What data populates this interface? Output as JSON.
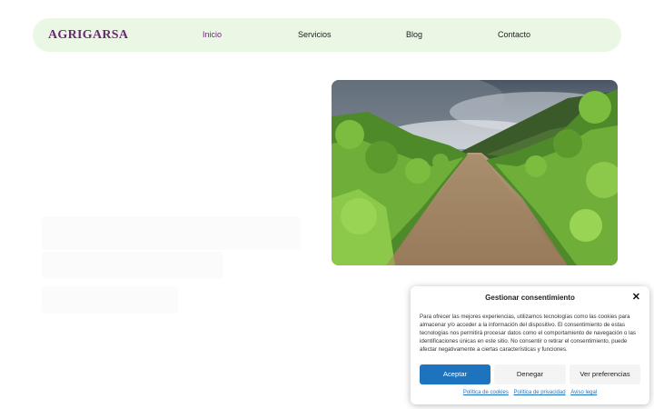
{
  "header": {
    "logo": "AGRIGARSA",
    "nav": [
      {
        "label": "Inicio"
      },
      {
        "label": "Servicios"
      },
      {
        "label": "Blog"
      },
      {
        "label": "Contacto"
      }
    ],
    "active_color": "#6a2a73",
    "background_color": "#e9f7e4"
  },
  "hero": {
    "image_icon": "vineyard-photo"
  },
  "cookie_banner": {
    "title": "Gestionar consentimiento",
    "close_icon": "close-icon",
    "text": "Para ofrecer las mejores experiencias, utilizamos tecnologías como las cookies para almacenar y/o acceder a la información del dispositivo. El consentimiento de estas tecnologías nos permitirá procesar datos como el comportamiento de navegación o las identificaciones únicas en este sitio. No consentir o retirar el consentimiento, puede afectar negativamente a ciertas características y funciones.",
    "buttons": {
      "accept": "Aceptar",
      "deny": "Denegar",
      "preferences": "Ver preferencias"
    },
    "links": {
      "cookies": "Política de cookies",
      "privacy": "Política de privacidad",
      "legal": "Aviso legal"
    },
    "accent_color": "#1e73be"
  }
}
